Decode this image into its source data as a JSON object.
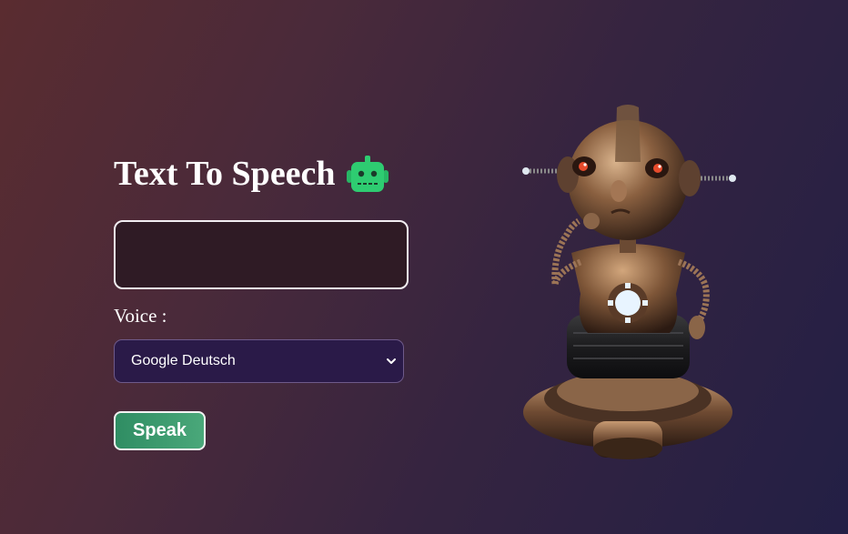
{
  "header": {
    "title": "Text To Speech",
    "title_icon": "robot-face-icon"
  },
  "form": {
    "text_input": {
      "value": "",
      "placeholder": ""
    },
    "voice_label": "Voice :",
    "voice_select": {
      "selected": "Google Deutsch",
      "icon": "chevron-down-icon"
    },
    "speak_button_label": "Speak"
  },
  "illustration": {
    "name": "robot-illustration"
  },
  "colors": {
    "background_start": "#5a2c30",
    "background_end": "#231f45",
    "button_green": "#3a9a6e",
    "select_bg": "#2a1a48",
    "input_bg": "#2f1b25",
    "robot_icon_green": "#2ecc71"
  }
}
